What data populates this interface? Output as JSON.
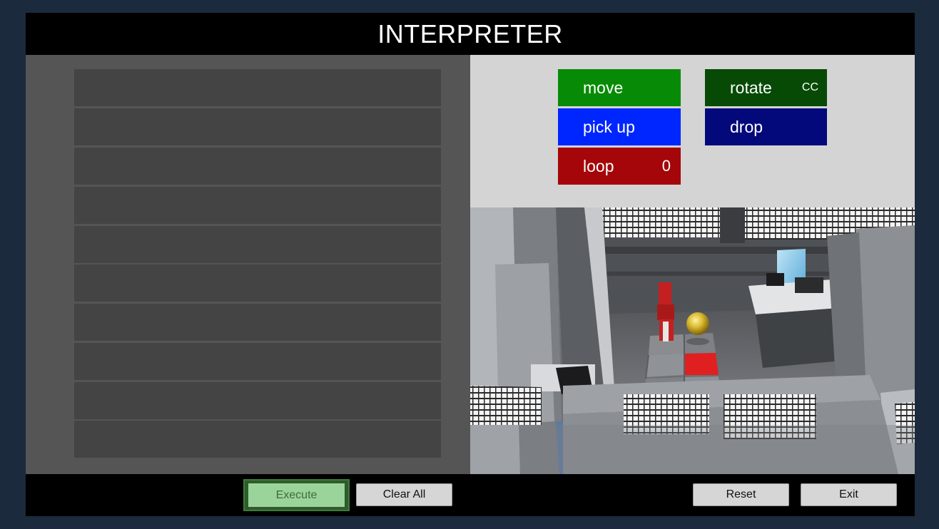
{
  "title": "INTERPRETER",
  "program": {
    "slots": [
      "",
      "",
      "",
      "",
      "",
      "",
      "",
      "",
      "",
      ""
    ]
  },
  "palette": {
    "move": {
      "label": "move",
      "color": "#078b06"
    },
    "rotate": {
      "label": "rotate",
      "value": "CC",
      "color": "#064a06"
    },
    "pick_up": {
      "label": "pick up",
      "color": "#0026ff"
    },
    "drop": {
      "label": "drop",
      "color": "#03097a"
    },
    "loop": {
      "label": "loop",
      "value": "0",
      "color": "#a4060a"
    }
  },
  "buttons": {
    "execute": "Execute",
    "clear_all": "Clear All",
    "reset": "Reset",
    "exit": "Exit"
  },
  "colors": {
    "background": "#1b2a3c",
    "target_tile": "#e02020",
    "robot": "#c02020",
    "ball": "#d8b72a"
  }
}
